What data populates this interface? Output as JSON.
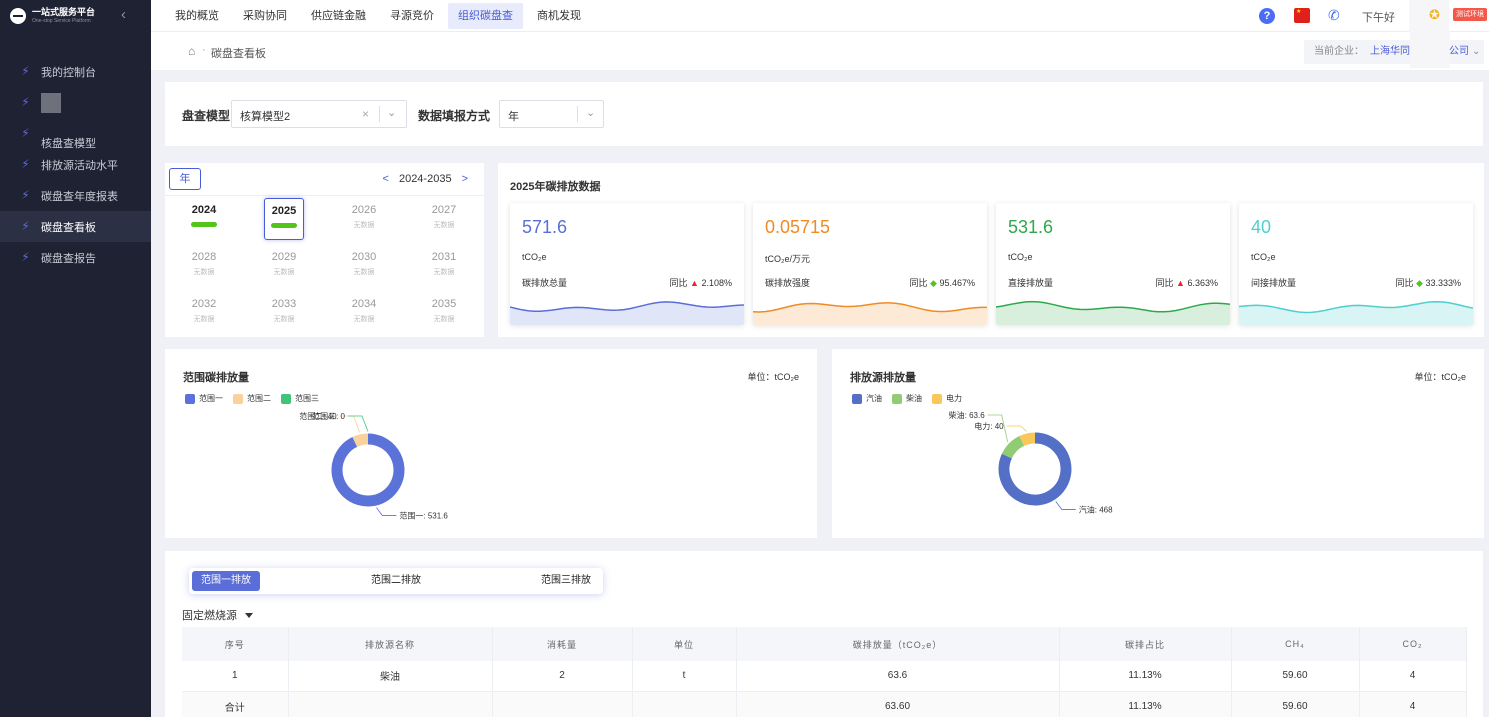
{
  "sidebar": {
    "logo_cn": "一站式服务平台",
    "logo_en": "One-stop Service Platform",
    "collapse_icon": "chevron-left-icon",
    "items": [
      {
        "label": "我的控制台"
      },
      {
        "label": ""
      },
      {
        "label": "核盘查模型"
      },
      {
        "label": "排放源活动水平"
      },
      {
        "label": "碳盘查年度报表"
      },
      {
        "label": "碳盘查看板"
      },
      {
        "label": "碳盘查报告"
      }
    ]
  },
  "topnav": {
    "items": [
      "我的概览",
      "采购协同",
      "供应链金融",
      "寻源竞价",
      "组织碳盘查",
      "商机发现"
    ],
    "active": "组织碳盘查",
    "greeting": "下午好",
    "env_badge": "测试环境"
  },
  "breadcrumb": {
    "current": "碳盘查看板",
    "company_label": "当前企业：",
    "company_value": "上海华同工贸",
    "company_suffix": "公司"
  },
  "filter": {
    "model_label": "盘查模型",
    "model_value": "核算模型2",
    "mode_label": "数据填报方式",
    "mode_value": "年"
  },
  "years": {
    "tab": "年",
    "range": "2024-2035",
    "prev": "<",
    "next": ">",
    "no_data": "无数据",
    "cells": [
      {
        "year": "2024",
        "has": true
      },
      {
        "year": "2025",
        "has": true,
        "selected": true
      },
      {
        "year": "2026",
        "has": false
      },
      {
        "year": "2027",
        "has": false
      },
      {
        "year": "2028",
        "has": false
      },
      {
        "year": "2029",
        "has": false
      },
      {
        "year": "2030",
        "has": false
      },
      {
        "year": "2031",
        "has": false
      },
      {
        "year": "2032",
        "has": false
      },
      {
        "year": "2033",
        "has": false
      },
      {
        "year": "2034",
        "has": false
      },
      {
        "year": "2035",
        "has": false
      }
    ]
  },
  "stats": {
    "title": "2025年碳排放数据",
    "yoy_label": "同比",
    "cards": [
      {
        "value": "571.6",
        "unit": "tCO₂e",
        "label": "碳排放总量",
        "yoy": "2.108%",
        "dir": "up",
        "color": "#5b6ed8"
      },
      {
        "value": "0.05715",
        "unit": "tCO₂e/万元",
        "label": "碳排放强度",
        "yoy": "95.467%",
        "dir": "down",
        "color": "#f08a24"
      },
      {
        "value": "531.6",
        "unit": "tCO₂e",
        "label": "直接排放量",
        "yoy": "6.363%",
        "dir": "up",
        "color": "#2ea84a"
      },
      {
        "value": "40",
        "unit": "tCO₂e",
        "label": "间接排放量",
        "yoy": "33.333%",
        "dir": "down",
        "color": "#4fcfcf"
      }
    ]
  },
  "chart_data": [
    {
      "type": "pie",
      "title": "范围碳排放量",
      "unit": "单位：tCO₂e",
      "labels": [
        "范围一",
        "范围二",
        "范围三"
      ],
      "values": [
        531.6,
        40,
        0
      ],
      "colors": [
        "#5b72d8",
        "#f8d29a",
        "#3fc47a"
      ],
      "point_labels": [
        "范围一: 531.6",
        "范围二: 40",
        "范围三: 0"
      ]
    },
    {
      "type": "pie",
      "title": "排放源排放量",
      "unit": "单位：tCO₂e",
      "labels": [
        "汽油",
        "柴油",
        "电力"
      ],
      "values": [
        468,
        63.6,
        40
      ],
      "colors": [
        "#5470c6",
        "#91cc75",
        "#fac858"
      ],
      "point_labels": [
        "汽油: 468",
        "柴油: 63.6",
        "电力: 40"
      ]
    }
  ],
  "table": {
    "tabs": [
      "范围一排放",
      "范围二排放",
      "范围三排放"
    ],
    "section": "固定燃烧源",
    "headers": [
      "序号",
      "排放源名称",
      "消耗量",
      "单位",
      "碳排放量（tCO₂e）",
      "碳排占比",
      "CH₄",
      "CO₂"
    ],
    "rows": [
      [
        "1",
        "柴油",
        "2",
        "t",
        "63.6",
        "11.13%",
        "59.60",
        "4"
      ],
      [
        "合计",
        "",
        "",
        "",
        "63.60",
        "11.13%",
        "59.60",
        "4"
      ]
    ]
  }
}
